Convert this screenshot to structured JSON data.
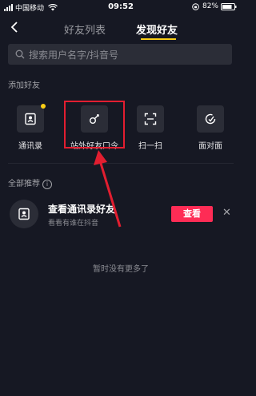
{
  "status_bar": {
    "carrier": "中国移动",
    "time": "09:52",
    "battery": "82%"
  },
  "nav": {
    "tabs": [
      {
        "label": "好友列表"
      },
      {
        "label": "发现好友"
      }
    ]
  },
  "search": {
    "placeholder": "搜索用户名字/抖音号"
  },
  "add_friends": {
    "heading": "添加好友",
    "items": [
      {
        "label": "通讯录",
        "icon": "contacts-icon"
      },
      {
        "label": "站外好友口令",
        "icon": "key-icon"
      },
      {
        "label": "扫一扫",
        "icon": "scan-icon"
      },
      {
        "label": "面对面",
        "icon": "face-to-face-icon"
      }
    ]
  },
  "recommend": {
    "heading": "全部推荐",
    "card": {
      "title": "查看通讯录好友",
      "subtitle": "看看有谁在抖音",
      "button": "查看"
    },
    "empty_text": "暂时没有更多了"
  },
  "colors": {
    "background": "#161823",
    "accent_red": "#fe2c55",
    "tab_indicator": "#face15",
    "annotation": "#e21e30"
  }
}
